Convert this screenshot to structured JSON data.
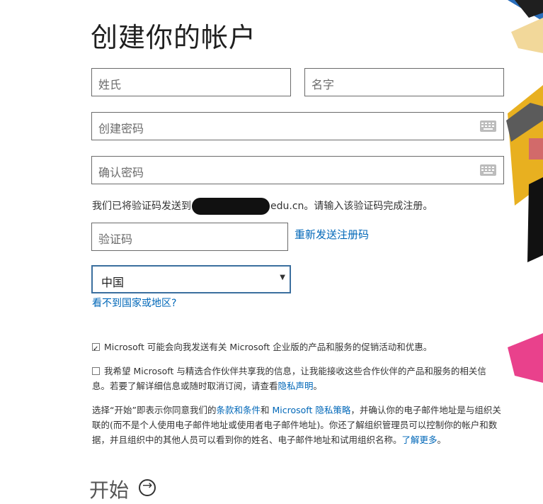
{
  "title": "创建你的帐户",
  "fields": {
    "last_name_placeholder": "姓氏",
    "first_name_placeholder": "名字",
    "password_placeholder": "创建密码",
    "confirm_password_placeholder": "确认密码",
    "code_placeholder": "验证码"
  },
  "verification": {
    "message_prefix": "我们已将验证码发送到",
    "email_suffix": "edu.cn",
    "message_suffix": "。请输入该验证码完成注册。",
    "resend_link": "重新发送注册码"
  },
  "country": {
    "selected": "中国",
    "missing_link": "看不到国家或地区?"
  },
  "consent": {
    "microsoft_promo": "Microsoft 可能会向我发送有关 Microsoft 企业版的产品和服务的促销活动和优惠。",
    "microsoft_promo_checked": true,
    "partner_share_text": "我希望 Microsoft 与精选合作伙伴共享我的信息，让我能接收这些合作伙伴的产品和服务的相关信息。若要了解详细信息或随时取消订阅，请查看",
    "partner_privacy_link": "隐私声明",
    "partner_share_end": "。",
    "partner_share_checked": false
  },
  "legal": {
    "part1": "选择“开始”即表示你同意我们的",
    "terms_link": "条款和条件",
    "and": "和",
    "privacy_link": "Microsoft 隐私策略",
    "part2": "，并确认你的电子邮件地址是与组织关联的(而不是个人使用电子邮件地址或使用者电子邮件地址)。你还了解组织管理员可以控制你的帐户和数据，并且组织中的其他人员可以看到你的姓名、电子邮件地址和试用组织名称。",
    "learn_more_link": "了解更多",
    "end": "。"
  },
  "start_button": "开始",
  "icons": {
    "keyboard": "keyboard-icon",
    "dropdown": "chevron-down-icon",
    "start": "arrow-right-circle-icon"
  },
  "colors": {
    "link": "#0067b8",
    "select_border": "#3b6f9e"
  }
}
